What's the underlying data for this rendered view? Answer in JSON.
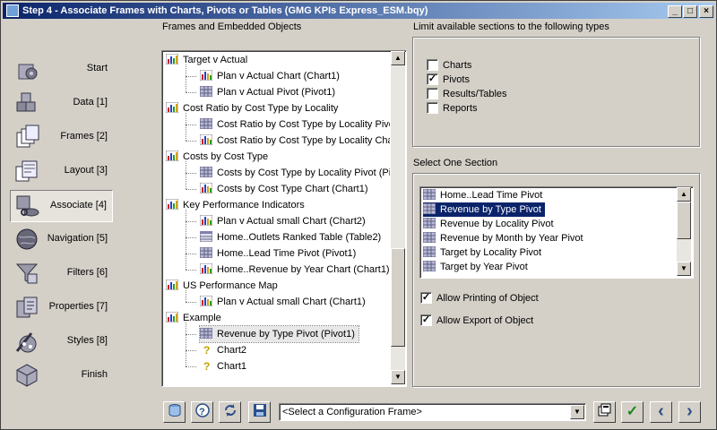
{
  "window": {
    "title": "Step 4 - Associate Frames with Charts, Pivots or Tables (GMG KPIs Express_ESM.bqy)",
    "minimize": "_",
    "maximize": "□",
    "close": "×"
  },
  "nav": [
    {
      "label": "Start",
      "icon": "start-icon"
    },
    {
      "label": "Data [1]",
      "icon": "data-icon"
    },
    {
      "label": "Frames [2]",
      "icon": "frames-icon"
    },
    {
      "label": "Layout [3]",
      "icon": "layout-icon"
    },
    {
      "label": "Associate [4]",
      "icon": "associate-icon"
    },
    {
      "label": "Navigation [5]",
      "icon": "navigation-icon"
    },
    {
      "label": "Filters [6]",
      "icon": "filters-icon"
    },
    {
      "label": "Properties [7]",
      "icon": "properties-icon"
    },
    {
      "label": "Styles [8]",
      "icon": "styles-icon"
    },
    {
      "label": "Finish",
      "icon": "finish-icon"
    }
  ],
  "frames_panel": {
    "label": "Frames and Embedded Objects",
    "tree": [
      {
        "text": "Target v Actual",
        "level": 0,
        "icon": "section-icon"
      },
      {
        "text": "Plan v Actual Chart (Chart1)",
        "level": 1,
        "icon": "chart-icon"
      },
      {
        "text": "Plan v Actual Pivot (Pivot1)",
        "level": 1,
        "icon": "pivot-icon"
      },
      {
        "text": "Cost Ratio by Cost Type by Locality",
        "level": 0,
        "icon": "section-icon"
      },
      {
        "text": "Cost Ratio by Cost Type by Locality Pivot",
        "level": 1,
        "icon": "pivot-icon"
      },
      {
        "text": "Cost Ratio by Cost Type by Locality Char",
        "level": 1,
        "icon": "chart-icon"
      },
      {
        "text": "Costs by Cost Type",
        "level": 0,
        "icon": "section-icon"
      },
      {
        "text": "Costs by Cost Type by Locality Pivot (Piv",
        "level": 1,
        "icon": "pivot-icon"
      },
      {
        "text": "Costs by Cost Type Chart (Chart1)",
        "level": 1,
        "icon": "chart-icon"
      },
      {
        "text": "Key Performance Indicators",
        "level": 0,
        "icon": "section-icon"
      },
      {
        "text": "Plan v Actual small Chart (Chart2)",
        "level": 1,
        "icon": "chart-icon"
      },
      {
        "text": "Home..Outlets Ranked Table (Table2)",
        "level": 1,
        "icon": "table-icon"
      },
      {
        "text": "Home..Lead Time Pivot (Pivot1)",
        "level": 1,
        "icon": "pivot-icon"
      },
      {
        "text": "Home..Revenue by Year Chart (Chart1)",
        "level": 1,
        "icon": "chart-icon"
      },
      {
        "text": "US Performance Map",
        "level": 0,
        "icon": "section-icon"
      },
      {
        "text": "Plan v Actual small Chart (Chart1)",
        "level": 1,
        "icon": "chart-icon"
      },
      {
        "text": "Example",
        "level": 0,
        "icon": "section-icon"
      },
      {
        "text": "Revenue by Type Pivot (Pivot1)",
        "level": 1,
        "icon": "pivot-icon",
        "selected": true
      },
      {
        "text": "Chart2",
        "level": 1,
        "icon": "unknown-icon"
      },
      {
        "text": "Chart1",
        "level": 1,
        "icon": "unknown-icon"
      }
    ]
  },
  "limit_panel": {
    "label": "Limit available sections to the following types",
    "options": [
      {
        "label": "Charts",
        "checked": false
      },
      {
        "label": "Pivots",
        "checked": true
      },
      {
        "label": "Results/Tables",
        "checked": false
      },
      {
        "label": "Reports",
        "checked": false
      }
    ]
  },
  "section_panel": {
    "label": "Select One Section",
    "items": [
      {
        "text": "Home..Lead Time Pivot",
        "selected": false
      },
      {
        "text": "Revenue by Type Pivot",
        "selected": true
      },
      {
        "text": "Revenue by Locality Pivot",
        "selected": false
      },
      {
        "text": "Revenue by Month by Year Pivot",
        "selected": false
      },
      {
        "text": "Target by Locality Pivot",
        "selected": false
      },
      {
        "text": "Target by Year Pivot",
        "selected": false
      }
    ],
    "allow_printing": {
      "label": "Allow Printing of Object",
      "checked": true
    },
    "allow_export": {
      "label": "Allow Export of Object",
      "checked": true
    }
  },
  "toolbar": {
    "config_placeholder": "<Select a Configuration Frame>",
    "check_mark": "✓",
    "back_arrow": "‹",
    "next_arrow": "›",
    "help": "?"
  },
  "colors": {
    "selection": "#0a246a",
    "face": "#d4d0c8",
    "title_start": "#0a246a"
  }
}
